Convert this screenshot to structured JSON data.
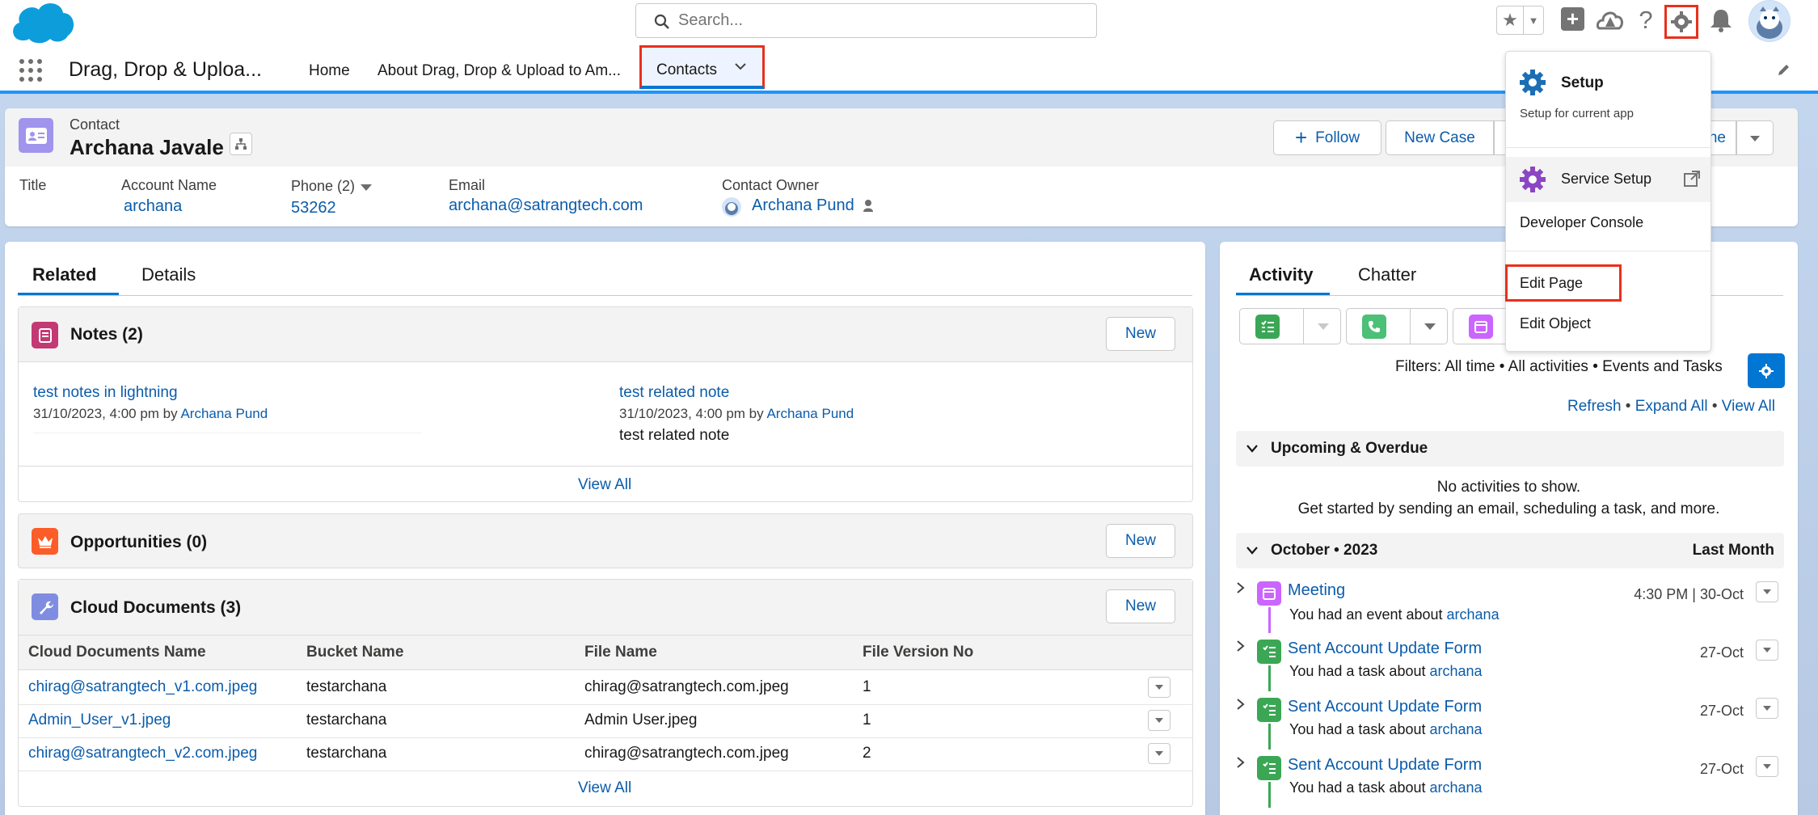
{
  "search": {
    "placeholder": "Search..."
  },
  "nav": {
    "app_name": "Drag, Drop & Uploa...",
    "tabs": [
      {
        "label": "Home"
      },
      {
        "label": "About Drag, Drop & Upload to Am..."
      },
      {
        "label": "Contacts"
      }
    ]
  },
  "record": {
    "object": "Contact",
    "name": "Archana Javale",
    "actions": {
      "follow": "Follow",
      "new_case": "New Case",
      "partial": "ne"
    },
    "fields": [
      {
        "label": "Title",
        "value": ""
      },
      {
        "label": "Account Name",
        "value": "archana"
      },
      {
        "label": "Phone (2)",
        "value": "53262"
      },
      {
        "label": "Email",
        "value": "archana@satrangtech.com"
      },
      {
        "label": "Contact Owner",
        "value": "Archana Pund"
      }
    ]
  },
  "left_tabs": [
    {
      "label": "Related"
    },
    {
      "label": "Details"
    }
  ],
  "notes": {
    "title": "Notes (2)",
    "new": "New",
    "view_all": "View All",
    "items": [
      {
        "title": "test notes in lightning",
        "meta": "31/10/2023, 4:00 pm by",
        "author": "Archana Pund",
        "body": ""
      },
      {
        "title": "test related note",
        "meta": "31/10/2023, 4:00 pm by",
        "author": "Archana Pund",
        "body": "test related note"
      }
    ]
  },
  "opportunities": {
    "title": "Opportunities (0)",
    "new": "New"
  },
  "cloud": {
    "title": "Cloud Documents (3)",
    "new": "New",
    "view_all": "View All",
    "columns": [
      "Cloud Documents Name",
      "Bucket Name",
      "File Name",
      "File Version No"
    ],
    "rows": [
      [
        "chirag@satrangtech_v1.com.jpeg",
        "testarchana",
        "chirag@satrangtech.com.jpeg",
        "1"
      ],
      [
        "Admin_User_v1.jpeg",
        "testarchana",
        "Admin User.jpeg",
        "1"
      ],
      [
        "chirag@satrangtech_v2.com.jpeg",
        "testarchana",
        "chirag@satrangtech.com.jpeg",
        "2"
      ]
    ]
  },
  "activity": {
    "tabs": [
      {
        "label": "Activity"
      },
      {
        "label": "Chatter"
      }
    ],
    "filters": "Filters: All time • All activities • Events and Tasks",
    "links": {
      "refresh": "Refresh",
      "expand": "Expand All",
      "view_all": "View All"
    },
    "upcoming": {
      "title": "Upcoming & Overdue",
      "empty1": "No activities to show.",
      "empty2": "Get started by sending an email, scheduling a task, and more."
    },
    "month": {
      "title": "October • 2023",
      "right": "Last Month"
    },
    "items": [
      {
        "title": "Meeting",
        "desc": "You had an event about",
        "link": "archana",
        "date": "4:30 PM | 30-Oct",
        "kind": "event"
      },
      {
        "title": "Sent Account Update Form",
        "desc": "You had a task about",
        "link": "archana",
        "date": "27-Oct",
        "kind": "task"
      },
      {
        "title": "Sent Account Update Form",
        "desc": "You had a task about",
        "link": "archana",
        "date": "27-Oct",
        "kind": "task"
      },
      {
        "title": "Sent Account Update Form",
        "desc": "You had a task about",
        "link": "archana",
        "date": "27-Oct",
        "kind": "task"
      }
    ]
  },
  "setup_menu": {
    "setup": "Setup",
    "setup_sub": "Setup for current app",
    "service_setup": "Service Setup",
    "dev_console": "Developer Console",
    "edit_page": "Edit Page",
    "edit_object": "Edit Object"
  },
  "colors": {
    "brand": "#0176d3",
    "highlight": "#e8301c",
    "notes": "#c23934",
    "opps": "#fc5c28",
    "cloud": "#54698d",
    "task": "#3ba755",
    "event": "#cb65ff",
    "contact": "#a094ed"
  }
}
